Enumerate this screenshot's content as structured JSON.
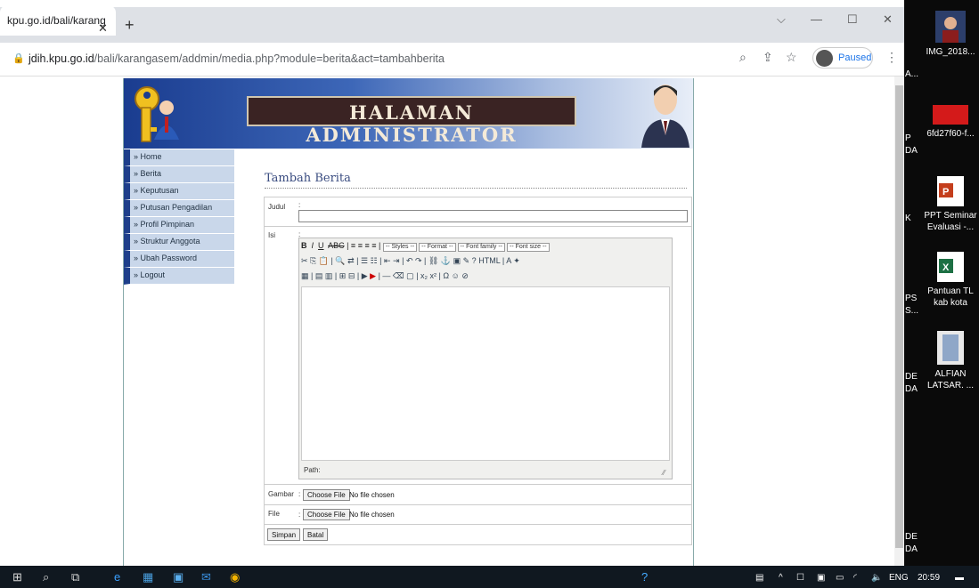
{
  "browser": {
    "tab_title": "kpu.go.id/bali/karang",
    "tab_close": "✕",
    "new_tab": "+",
    "url_host": "jdih.kpu.go.id",
    "url_path": "/bali/karangasem/addmin/media.php?module=berita&act=tambahberita",
    "profile_label": "Paused",
    "window_min": "—",
    "window_max": "☐",
    "window_close": "✕"
  },
  "banner": {
    "title": "HALAMAN ADMINISTRATOR"
  },
  "menu": {
    "items": [
      {
        "label": "» Home"
      },
      {
        "label": "» Berita"
      },
      {
        "label": "» Keputusan"
      },
      {
        "label": "» Putusan Pengadilan"
      },
      {
        "label": "» Profil Pimpinan"
      },
      {
        "label": "» Struktur Anggota"
      },
      {
        "label": "» Ubah Password"
      },
      {
        "label": "» Logout"
      }
    ]
  },
  "form": {
    "title": "Tambah Berita",
    "judul_label": "Judul",
    "judul_value": "",
    "isi_label": "Isi",
    "colon": ":",
    "editor": {
      "styles": "-- Styles --",
      "format": "-- Format --",
      "font_family": "-- Font family --",
      "font_size": "-- Font size --",
      "path_label": "Path:"
    },
    "gambar_label": "Gambar",
    "file_label": "File",
    "choose_file": "Choose File",
    "no_file": "No file chosen",
    "simpan": "Simpan",
    "batal": "Batal"
  },
  "desktop": {
    "icons": [
      {
        "label": "IMG_2018..."
      },
      {
        "label": "6fd27f60-f..."
      },
      {
        "label": "PPT Seminar Evaluasi -..."
      },
      {
        "label": "Pantuan TL kab kota"
      },
      {
        "label": "ALFIAN LATSAR. ..."
      }
    ],
    "partial": [
      "A...",
      "P",
      "DA",
      "K",
      "PS",
      "S...",
      "DE",
      "DA",
      "DE",
      "DA"
    ]
  },
  "taskbar": {
    "lang": "ENG",
    "time": "20:59"
  }
}
